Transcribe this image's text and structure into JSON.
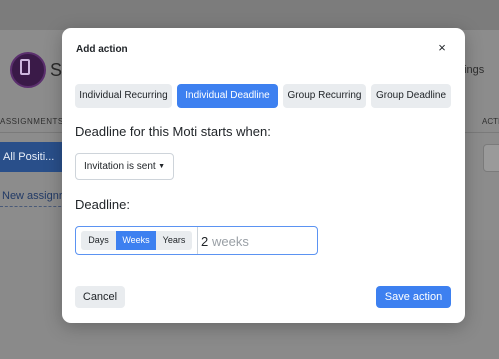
{
  "background": {
    "title_fragment": "Sv",
    "right_link_fragment": "ttings",
    "column_header_left": "ASSIGNMENTS FOR",
    "column_header_right": "ACTI",
    "selected_position": "All Positi...",
    "new_link": "New assignr"
  },
  "modal": {
    "title": "Add action",
    "close_label": "×",
    "tabs": [
      {
        "label": "Individual Recurring",
        "active": false
      },
      {
        "label": "Individual Deadline",
        "active": true
      },
      {
        "label": "Group Recurring",
        "active": false
      },
      {
        "label": "Group Deadline",
        "active": false
      }
    ],
    "starts_label": "Deadline for this Moti starts when:",
    "start_select": {
      "value": "Invitation is sent",
      "caret": "▼"
    },
    "deadline_label": "Deadline:",
    "units": [
      {
        "label": "Days",
        "active": false
      },
      {
        "label": "Weeks",
        "active": true
      },
      {
        "label": "Years",
        "active": false
      }
    ],
    "deadline_value": "2",
    "deadline_unit_placeholder": "weeks",
    "cancel_label": "Cancel",
    "save_label": "Save action"
  },
  "colors": {
    "accent": "#3d80f0",
    "overlay": "#8a8a8a",
    "tab_inactive": "#e9ecef"
  }
}
